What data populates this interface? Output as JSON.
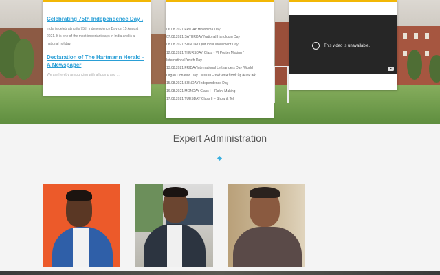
{
  "news": {
    "items": [
      {
        "title": "Celebrating 75th Independence Day ,",
        "text": "India is celebrating its 75th Independence Day on 15 August 2021. It is one of the most important days in India and is a national holiday."
      },
      {
        "title": "Declaration of The Hartmann Herald - A Newspaper",
        "text": "We are hereby announcing with all pomp and ..."
      }
    ]
  },
  "events": {
    "items": [
      "06.08.2021 FRIDAY Hiroshima Day",
      "07.08.2021 SATURDAY National Handloom Day",
      "08.08.2021 SUNDAY Quit India Movement Day",
      "12.08.2021 THURSDAY Class - VI Poster Making /",
      "International Youth Day",
      "13.08.2021 FRIDAYInternational Lefthanders Day /World",
      "Organ Donation Day Class III – चलो अपन पिराखे देह के दान करे",
      "15.08.2021 SUNDAY Independence Day",
      "16.08.2021 MONDAY Class I – Rakhi Making",
      "17.08.2021 TUESDAY Class II – Show & Tell"
    ]
  },
  "video": {
    "message": "This video is unavailable."
  },
  "section": {
    "title": "Expert Administration"
  },
  "colors": {
    "accent_bar": "#f2b705",
    "link": "#2a9fd6",
    "diamond": "#3bb0e0"
  }
}
